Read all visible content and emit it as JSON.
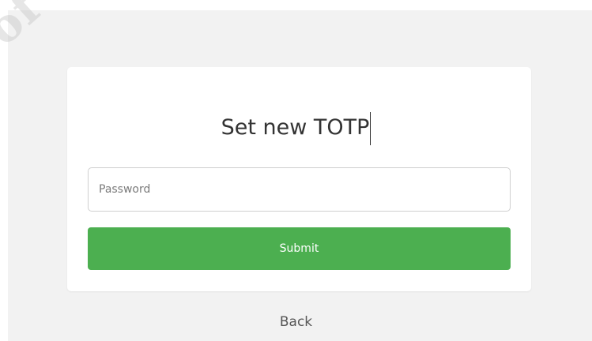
{
  "form": {
    "title": "Set new TOTP",
    "password_placeholder": "Password",
    "password_value": "",
    "submit_label": "Submit"
  },
  "back_link": "Back",
  "watermark": "of Infor",
  "colors": {
    "accent": "#4caf50",
    "panel_bg": "#f2f2f2",
    "card_bg": "#ffffff"
  }
}
